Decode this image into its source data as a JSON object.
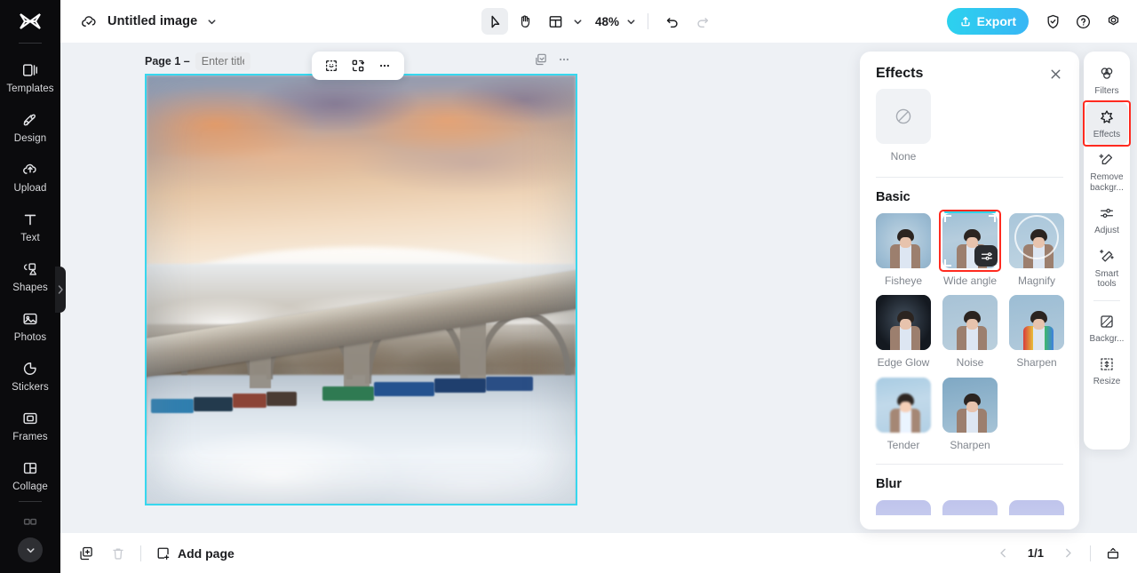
{
  "sidebar": {
    "brand_icon": "capcut-logo-icon",
    "items": [
      {
        "label": "Templates",
        "icon": "templates-icon"
      },
      {
        "label": "Design",
        "icon": "design-icon"
      },
      {
        "label": "Upload",
        "icon": "upload-cloud-icon"
      },
      {
        "label": "Text",
        "icon": "text-icon"
      },
      {
        "label": "Shapes",
        "icon": "shapes-icon"
      },
      {
        "label": "Photos",
        "icon": "photos-icon"
      },
      {
        "label": "Stickers",
        "icon": "stickers-icon"
      },
      {
        "label": "Frames",
        "icon": "frames-icon"
      },
      {
        "label": "Collage",
        "icon": "collage-icon"
      }
    ],
    "collapse_icon": "chevron-down-icon",
    "handle_icon": "chevron-right-icon"
  },
  "topbar": {
    "cloud_icon": "cloud-saved-icon",
    "doc_title": "Untitled image",
    "title_chevron_icon": "chevron-down-icon",
    "tools": [
      {
        "name": "select-tool",
        "icon": "cursor-arrow-icon",
        "active": true
      },
      {
        "name": "hand-tool",
        "icon": "hand-icon",
        "active": false
      },
      {
        "name": "layout-tool",
        "icon": "layout-grid-icon",
        "active": false
      }
    ],
    "layout_chevron_icon": "chevron-down-icon",
    "zoom_level": "48%",
    "zoom_chevron_icon": "chevron-down-icon",
    "undo_icon": "undo-icon",
    "redo_icon": "redo-icon",
    "export_label": "Export",
    "export_icon": "upload-share-icon",
    "shield_icon": "shield-check-icon",
    "help_icon": "question-circle-icon",
    "settings_icon": "gear-icon",
    "export_color": "#2cd2ee"
  },
  "canvas": {
    "page_label": "Page 1 –",
    "title_placeholder": "Enter title",
    "title_value": "",
    "float_toolbar": [
      {
        "name": "crop-select-button",
        "icon": "crop-select-icon"
      },
      {
        "name": "replace-media-button",
        "icon": "replace-swap-icon"
      },
      {
        "name": "more-options-button",
        "icon": "ellipsis-icon"
      }
    ],
    "page_actions": [
      {
        "name": "duplicate-page-button",
        "icon": "duplicate-icon"
      },
      {
        "name": "page-menu-button",
        "icon": "ellipsis-icon"
      }
    ],
    "selection_color": "#37d7ee",
    "image_alt": "Aerial winter landscape: sunset sky over snowy river valley with arched bridge and freight train"
  },
  "bottombar": {
    "duplicate_icon": "duplicate-icon",
    "delete_icon": "trash-icon",
    "add_page_label": "Add page",
    "add_page_icon": "add-page-icon",
    "prev_icon": "chevron-left-icon",
    "next_icon": "chevron-right-icon",
    "page_count": "1/1",
    "present_icon": "present-icon"
  },
  "panel": {
    "title": "Effects",
    "close_icon": "close-icon",
    "none": {
      "label": "None",
      "icon": "no-effect-icon"
    },
    "sections": [
      {
        "title": "Basic",
        "items": [
          {
            "label": "Fisheye",
            "selected": false
          },
          {
            "label": "Wide angle",
            "selected": true
          },
          {
            "label": "Magnify",
            "selected": false
          },
          {
            "label": "Edge Glow",
            "selected": false
          },
          {
            "label": "Noise",
            "selected": false
          },
          {
            "label": "Sharpen",
            "selected": false
          },
          {
            "label": "Tender",
            "selected": false
          },
          {
            "label": "Sharpen",
            "selected": false
          }
        ]
      },
      {
        "title": "Blur",
        "items": []
      }
    ],
    "selected_badge_icon": "adjust-sliders-icon",
    "highlight_color": "#ff2a1f",
    "accent_color": "#2fd4e8"
  },
  "rail": {
    "items": [
      {
        "label": "Filters",
        "icon": "filters-icon",
        "active": false,
        "highlighted": false
      },
      {
        "label": "Effects",
        "icon": "effects-star-icon",
        "active": true,
        "highlighted": true
      },
      {
        "label": "Remove\nbackgr...",
        "icon": "remove-background-icon",
        "active": false,
        "highlighted": false
      },
      {
        "label": "Adjust",
        "icon": "adjust-sliders-icon",
        "active": false,
        "highlighted": false
      },
      {
        "label": "Smart\ntools",
        "icon": "smart-tools-icon",
        "active": false,
        "highlighted": false
      }
    ],
    "items_after_divider": [
      {
        "label": "Backgr...",
        "icon": "background-icon",
        "active": false,
        "highlighted": false
      },
      {
        "label": "Resize",
        "icon": "resize-icon",
        "active": false,
        "highlighted": false
      }
    ]
  }
}
